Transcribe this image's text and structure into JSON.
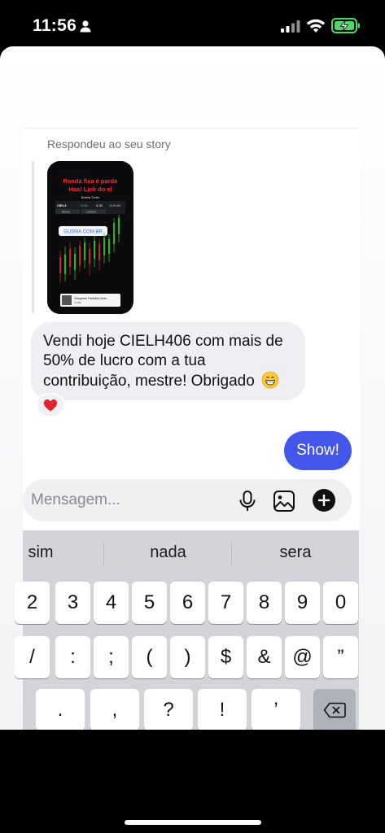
{
  "status_bar": {
    "time": "11:56",
    "icons": [
      "person-icon",
      "signal-icon",
      "wifi-icon",
      "battery-charging-icon"
    ],
    "battery_color": "#4cd964"
  },
  "thread": {
    "replied_label": "Respondeu ao seu story",
    "story": {
      "headline_line1": "Renda fixa é parda",
      "headline_line2": "Haa! Link do el",
      "app_title": "Boleta Turbo",
      "ticker": "CIEL3",
      "change": "+4,61",
      "price": "4,34",
      "time": "13:04:09",
      "tab1": "Boleta",
      "tab2": "Carteira",
      "link_sticker": "GUSMA.COM.BR",
      "music_title": "Gangsta's Paradise (feat ...",
      "music_artist": "Coolio"
    },
    "incoming_message": {
      "text": "Vendi hoje CIELH406 com mais de 50% de lucro com a tua contribuição, mestre! Obrigado",
      "emoji": "grinning-face-icon",
      "reaction": "heart-icon"
    },
    "outgoing_message": {
      "text": "Show!",
      "color": "#4358ea"
    }
  },
  "composer": {
    "placeholder": "Mensagem...",
    "icons": [
      "microphone-icon",
      "gallery-icon",
      "add-icon"
    ]
  },
  "keyboard": {
    "suggestions": [
      "sim",
      "nada",
      "sera"
    ],
    "row1": [
      "2",
      "3",
      "4",
      "5",
      "6",
      "7",
      "8",
      "9",
      "0"
    ],
    "row2": [
      "/",
      ":",
      ";",
      "(",
      ")",
      "$",
      "&",
      "@",
      "”"
    ],
    "row3": [
      ".",
      ",",
      "?",
      "!",
      "’"
    ],
    "delete_icon": "backspace-icon"
  }
}
